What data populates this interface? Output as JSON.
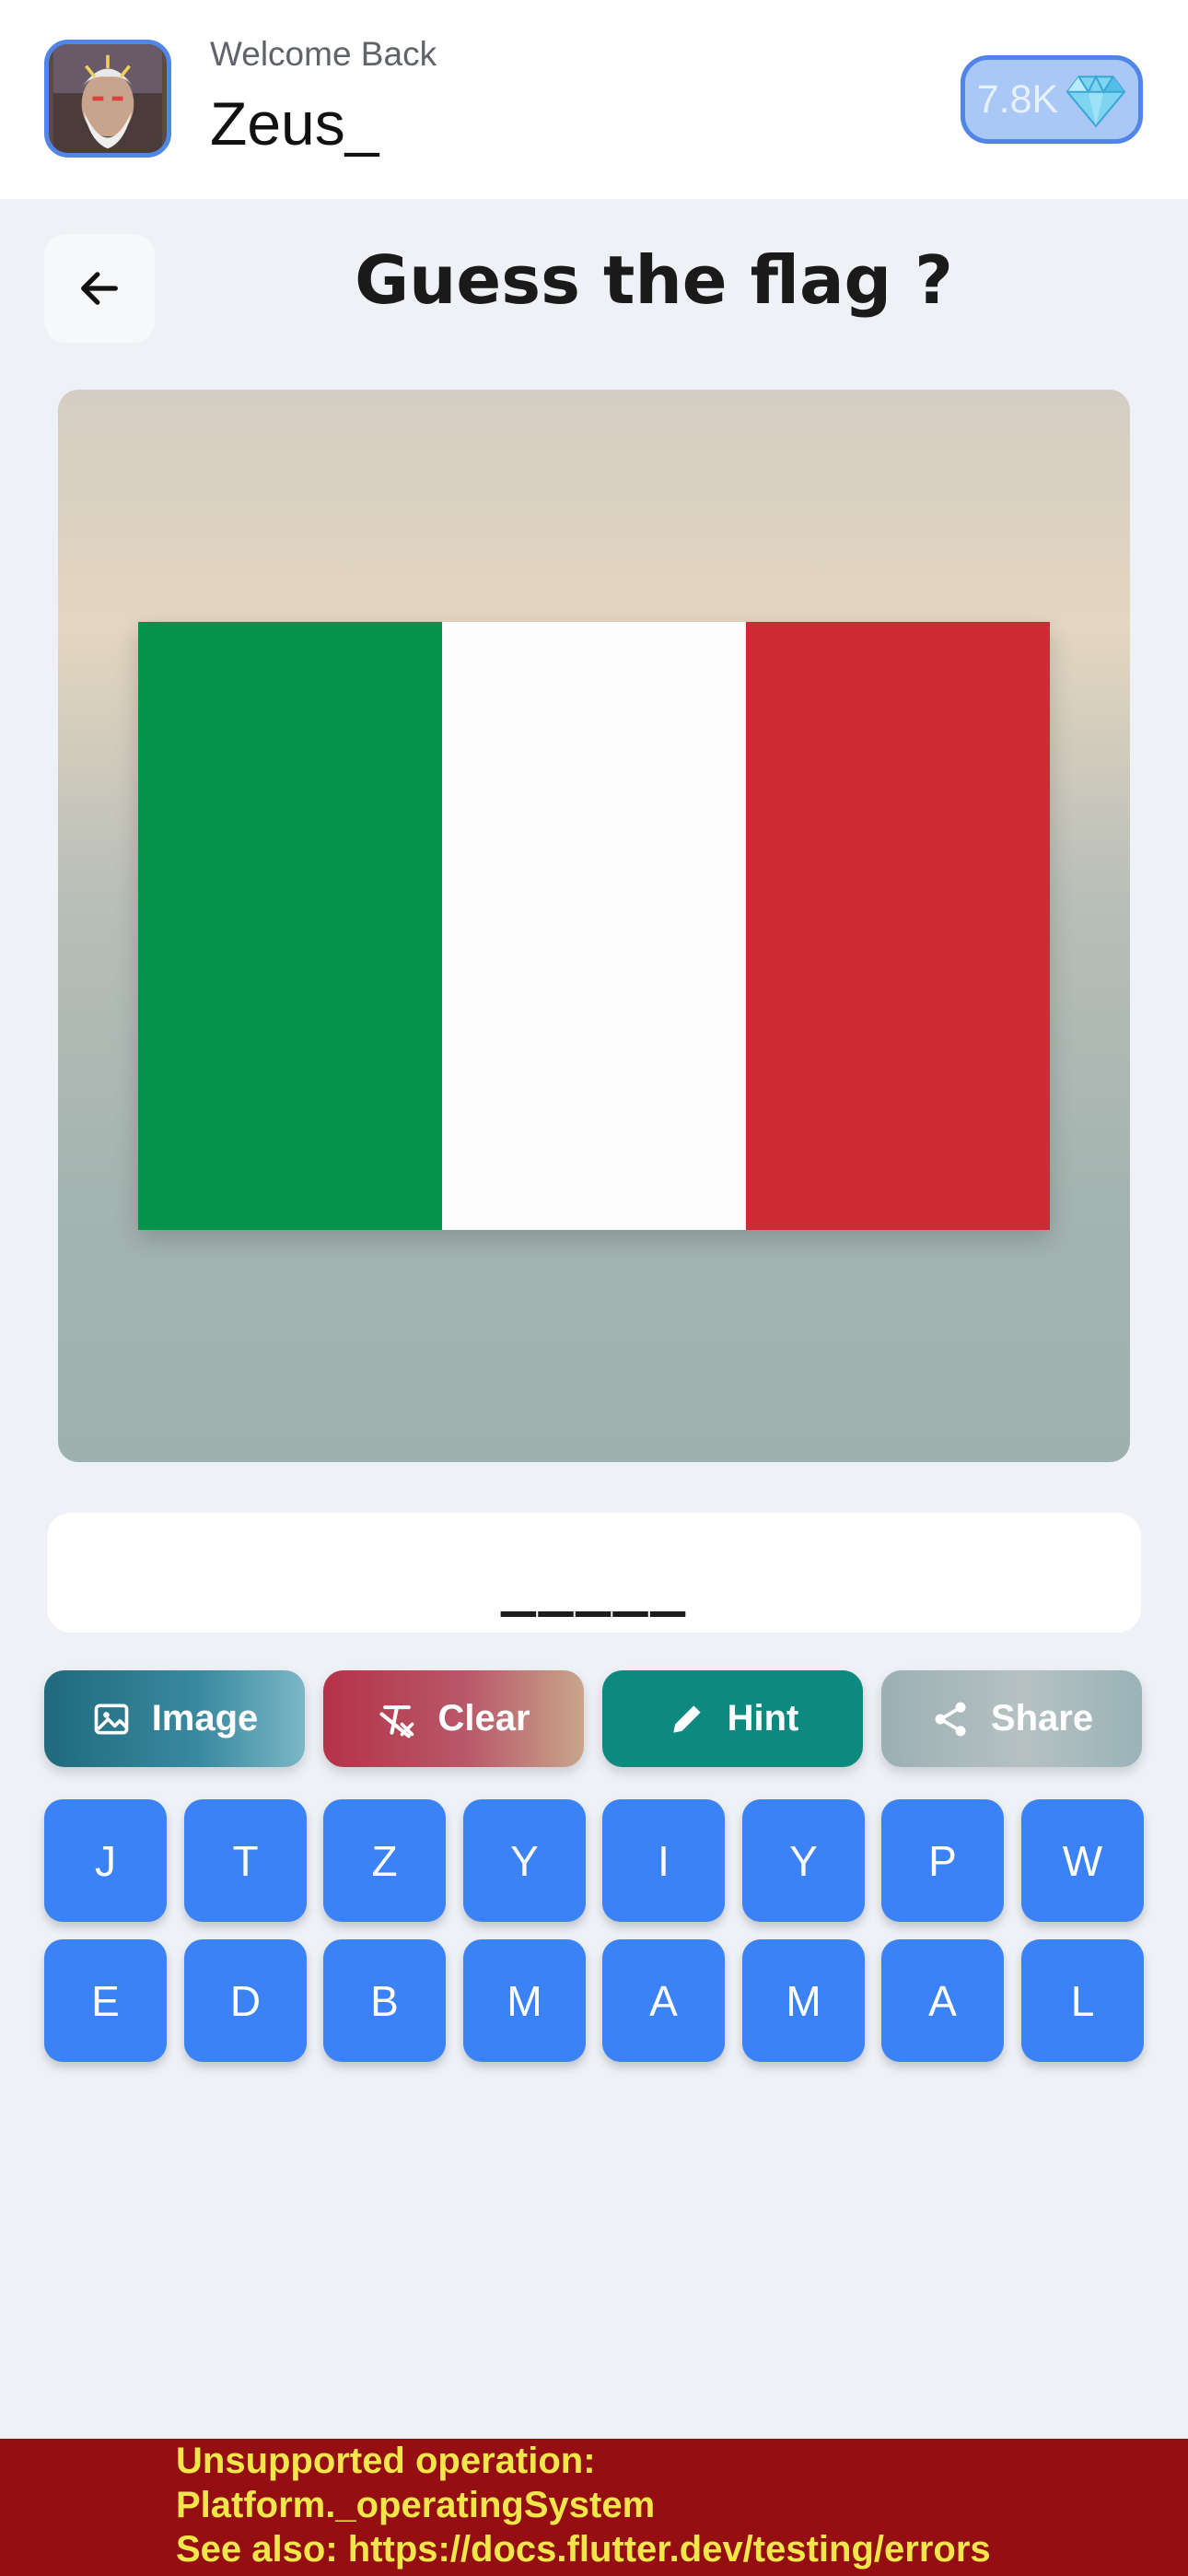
{
  "header": {
    "welcome_text": "Welcome Back",
    "username": "Zeus_",
    "gems": "7.8K"
  },
  "page": {
    "title": "Guess the flag ?"
  },
  "flag": {
    "colors": [
      "#05924a",
      "#fdfdfd",
      "#cf2b37"
    ]
  },
  "answer": {
    "slots": "_____"
  },
  "actions": [
    {
      "label": "Image",
      "icon": "image-icon"
    },
    {
      "label": "Clear",
      "icon": "clear-format-icon"
    },
    {
      "label": "Hint",
      "icon": "pencil-icon"
    },
    {
      "label": "Share",
      "icon": "share-icon"
    }
  ],
  "letters": {
    "row1": [
      "J",
      "T",
      "Z",
      "Y",
      "I",
      "Y",
      "P",
      "W"
    ],
    "row2": [
      "E",
      "D",
      "B",
      "M",
      "A",
      "M",
      "A",
      "L"
    ]
  },
  "error": {
    "line1": "Unsupported operation:",
    "line2": "Platform._operatingSystem",
    "line3": "See also: https://docs.flutter.dev/testing/errors"
  },
  "colors": {
    "accent": "#3b82f6",
    "avatar_border": "#4f86e8",
    "error_bg": "#950f12",
    "error_text": "#f2e64a"
  }
}
